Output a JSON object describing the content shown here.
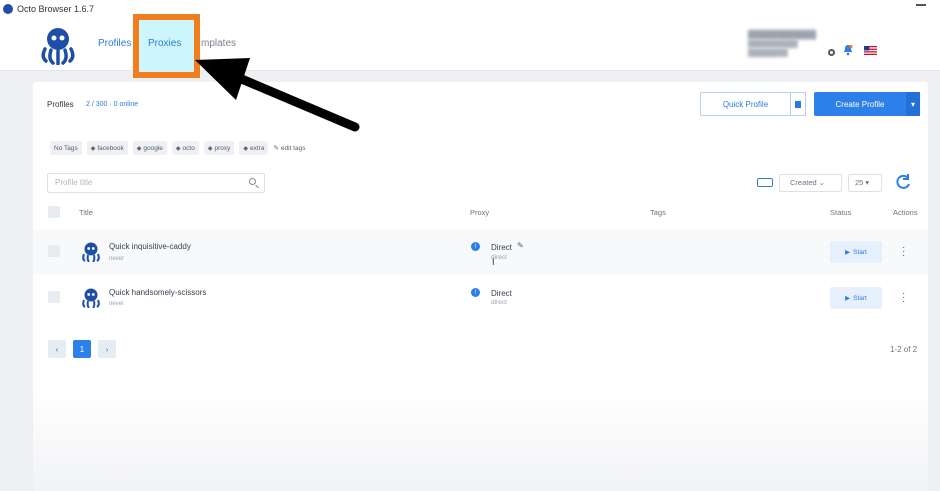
{
  "window": {
    "title": "Octo Browser 1.6.7"
  },
  "nav": {
    "profiles": "Profiles",
    "proxies": "Proxies",
    "templates": "mplates"
  },
  "header": {
    "quick_profile": "Quick Profile",
    "create_profile": "Create Profile",
    "title": "Profiles",
    "count": "2 / 300 · 0 online"
  },
  "tags": [
    "No Tags",
    "facebook",
    "google",
    "octo",
    "proxy",
    "extra"
  ],
  "edit_tags": "edit tags",
  "search": {
    "placeholder": "Profile title"
  },
  "sort": {
    "value": "Created ⌄"
  },
  "per_page": {
    "value": "25 ▾"
  },
  "columns": {
    "title": "Title",
    "proxy": "Proxy",
    "tags": "Tags",
    "status": "Status",
    "actions": "Actions"
  },
  "rows": [
    {
      "title": "Quick inquisitive-caddy",
      "sub": "never",
      "proxy": "Direct",
      "proxy_sub": "direct",
      "start": "Start"
    },
    {
      "title": "Quick handsomely-scissors",
      "sub": "never",
      "proxy": "Direct",
      "proxy_sub": "direct",
      "start": "Start"
    }
  ],
  "pager": {
    "prev": "‹",
    "page": "1",
    "next": "›",
    "range": "1-2 of 2"
  },
  "colors": {
    "accent": "#2d80ea",
    "highlight_border": "#f07d1e",
    "highlight_fill": "#cdf6fc"
  }
}
